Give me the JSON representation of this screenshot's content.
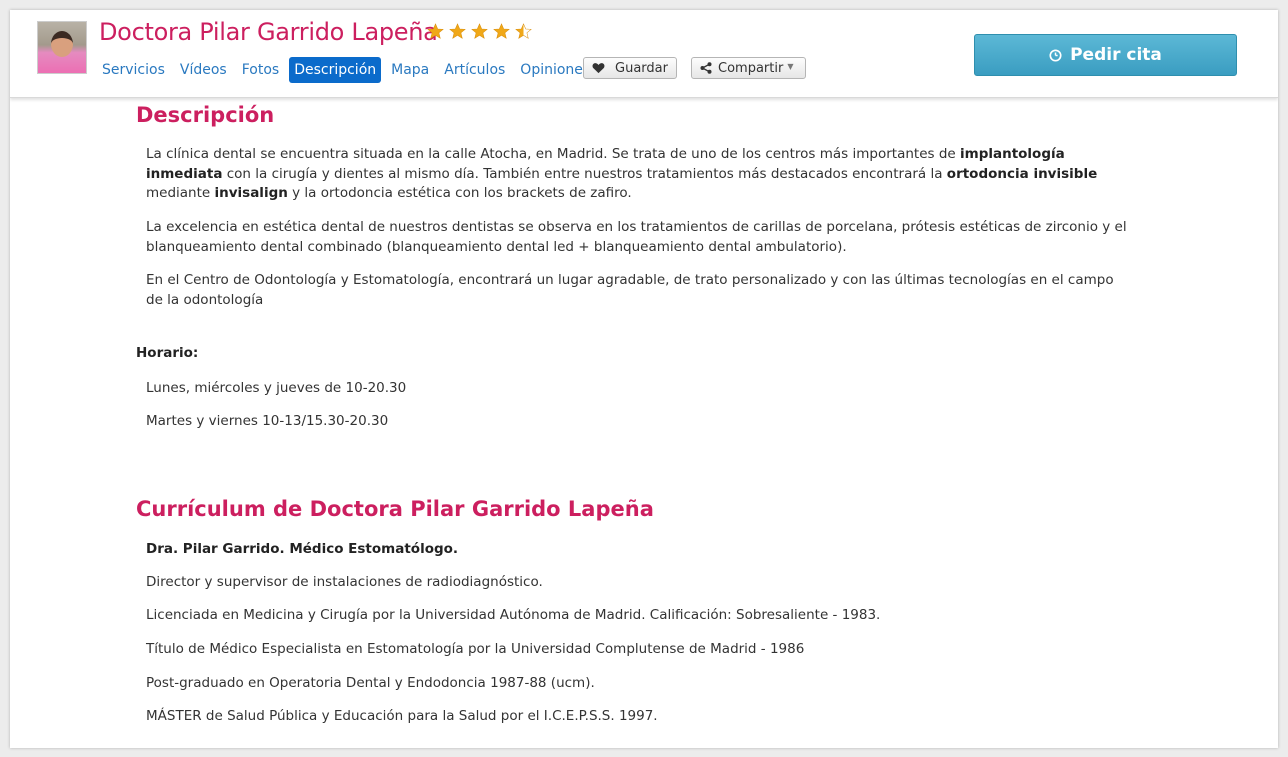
{
  "header": {
    "doctor_name": "Doctora Pilar Garrido Lapeña",
    "rating": 4.5,
    "rating_max": 5,
    "star_color": "#f0a818",
    "nav": [
      {
        "label": "Servicios",
        "active": false
      },
      {
        "label": "Vídeos",
        "active": false
      },
      {
        "label": "Fotos",
        "active": false
      },
      {
        "label": "Descripción",
        "active": true
      },
      {
        "label": "Mapa",
        "active": false
      },
      {
        "label": "Artículos",
        "active": false
      },
      {
        "label": "Opiniones",
        "active": false
      }
    ],
    "save_label": "Guardar",
    "share_label": "Compartir",
    "appointment_label": "Pedir cita",
    "icons": {
      "save": "heart-icon",
      "share": "share-icon",
      "appointment": "clock-icon"
    }
  },
  "descripcion": {
    "title": "Descripción",
    "p1": {
      "a": "La clínica dental se encuentra situada en la calle Atocha, en Madrid. Se trata de uno de los centros más importantes de ",
      "b1": "implantología inmediata",
      "c": " con la cirugía y dientes al mismo día. También entre nuestros tratamientos más destacados encontrará la ",
      "b2": "ortodoncia invisible",
      "d": " mediante ",
      "b3": "invisalign",
      "e": " y la ortodoncia estética con los brackets de zafiro."
    },
    "p2": "La excelencia en estética dental de nuestros dentistas se observa en los tratamientos de carillas de porcelana, prótesis estéticas de zirconio y el blanqueamiento dental combinado (blanqueamiento dental led + blanqueamiento dental ambulatorio).",
    "p3": "En el Centro de Odontología y Estomatología, encontrará un lugar agradable, de trato personalizado y con las últimas tecnologías en el campo de la odontología",
    "horario_label": "Horario:",
    "horario": [
      "Lunes, miércoles y jueves de 10-20.30",
      "Martes y viernes 10-13/15.30-20.30"
    ]
  },
  "curriculum": {
    "title": "Currículum de Doctora Pilar Garrido Lapeña",
    "heading": "Dra. Pilar Garrido. Médico Estomatólogo.",
    "items": [
      "Director y supervisor de instalaciones de radiodiagnóstico.",
      "Licenciada en Medicina y Cirugía por la Universidad Autónoma de Madrid. Calificación: Sobresaliente - 1983.",
      "Título de Médico Especialista en Estomatología por la Universidad Complutense de Madrid - 1986",
      "Post-graduado en Operatoria Dental y Endodoncia 1987-88 (ucm).",
      "MÁSTER de Salud Pública y Educación para la Salud por el I.C.E.P.S.S. 1997."
    ]
  }
}
